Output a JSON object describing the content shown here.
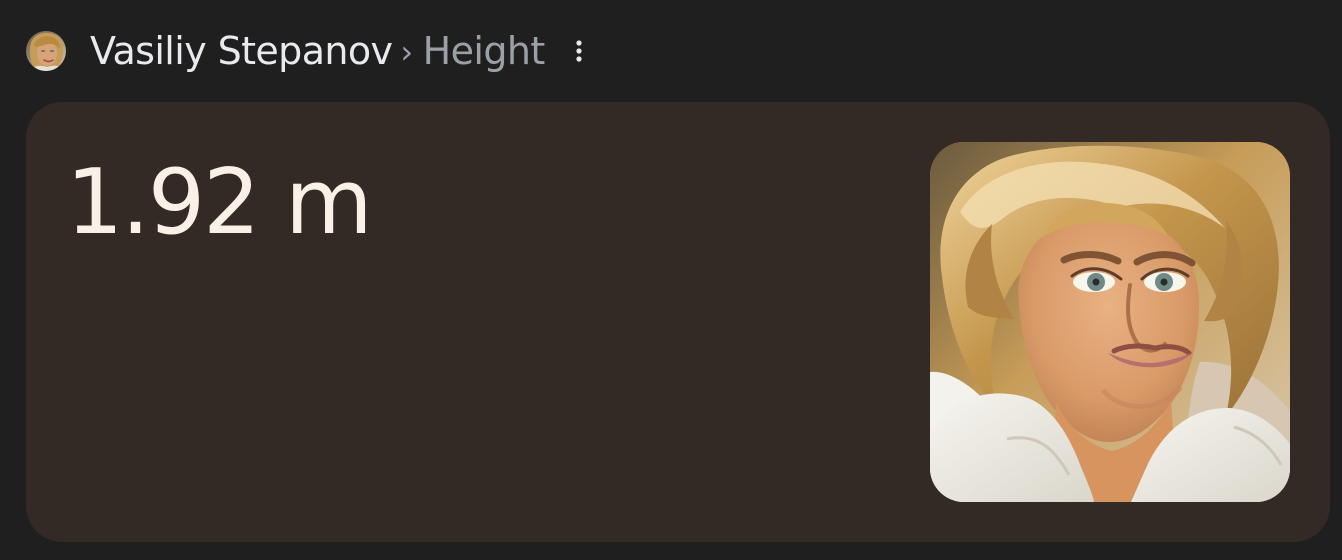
{
  "header": {
    "entity_name": "Vasiliy Stepanov",
    "separator": "›",
    "attribute": "Height",
    "avatar_icon": "person-avatar-icon",
    "more_icon": "more-vert-icon"
  },
  "answer": {
    "value": "1.92 m"
  },
  "colors": {
    "page_background": "#1f1f1f",
    "card_background": "#332a26",
    "value_text": "#fbf0e8",
    "title_text": "#e8eaed",
    "muted_text": "#9aa0a6"
  }
}
